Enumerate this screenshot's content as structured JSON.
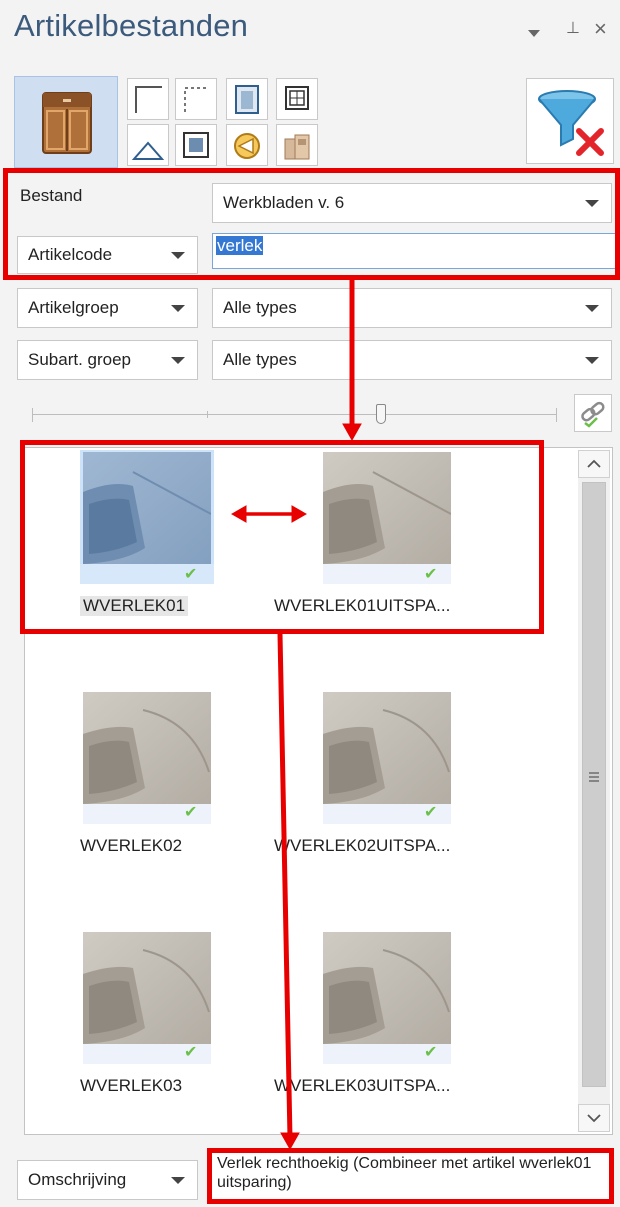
{
  "panel": {
    "title": "Artikelbestanden",
    "controls": [
      "pin-icon",
      "close-icon"
    ],
    "pin_glyph": "⊥",
    "close_glyph": "×",
    "dropdown_glyph": "▼"
  },
  "toolbar": {
    "icons": [
      "cabinet-icon",
      "corner-icon",
      "dotted-corner-icon",
      "door-icon",
      "grid-panel-icon",
      "triangle-icon",
      "square-panel-icon",
      "disc-icon",
      "appliance-icon",
      "filter-clear-icon"
    ]
  },
  "filters": {
    "bestand_label": "Bestand",
    "bestand_value": "Werkbladen v. 6",
    "code_field_label": "Artikelcode",
    "code_value": "verlek",
    "group_label": "Artikelgroep",
    "group_value": "Alle types",
    "subgroup_label": "Subart. groep",
    "subgroup_value": "Alle types"
  },
  "items": [
    {
      "code": "WVERLEK01",
      "selected": true
    },
    {
      "code": "WVERLEK01UITSPA...",
      "selected": false
    },
    {
      "code": "WVERLEK02",
      "selected": false
    },
    {
      "code": "WVERLEK02UITSPA...",
      "selected": false
    },
    {
      "code": "WVERLEK03",
      "selected": false
    },
    {
      "code": "WVERLEK03UITSPA...",
      "selected": false
    }
  ],
  "footer": {
    "field_label": "Omschrijving",
    "description": "Verlek rechthoekig (Combineer met artikel wverlek01 uitsparing)"
  },
  "colors": {
    "accent": "#3478d4",
    "annotation": "#e80000",
    "title": "#3b5a7c",
    "selection": "#cde3fa",
    "check": "#6cc04a"
  }
}
